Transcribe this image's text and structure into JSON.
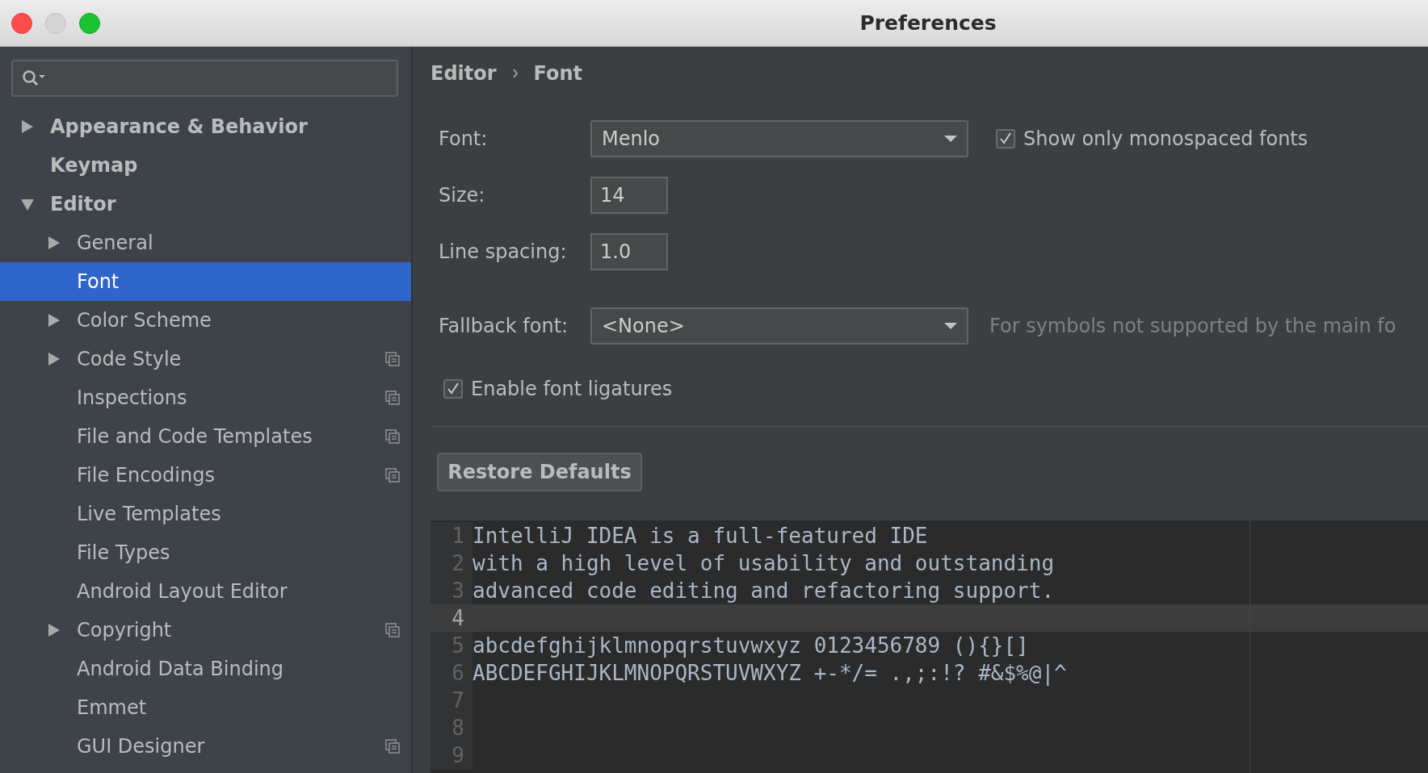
{
  "window": {
    "title": "Preferences"
  },
  "sidebar": {
    "tree": [
      {
        "label": "Appearance & Behavior",
        "kind": "node",
        "expanded": false,
        "bold": true,
        "selected": false,
        "project_icon": false
      },
      {
        "label": "Keymap",
        "kind": "leaf",
        "bold": true,
        "selected": false,
        "project_icon": false
      },
      {
        "label": "Editor",
        "kind": "node",
        "expanded": true,
        "bold": true,
        "selected": false,
        "project_icon": false,
        "children": [
          {
            "label": "General",
            "kind": "node",
            "expanded": false,
            "bold": false,
            "selected": false,
            "project_icon": false
          },
          {
            "label": "Font",
            "kind": "leaf",
            "bold": false,
            "selected": true,
            "project_icon": false
          },
          {
            "label": "Color Scheme",
            "kind": "node",
            "expanded": false,
            "bold": false,
            "selected": false,
            "project_icon": false
          },
          {
            "label": "Code Style",
            "kind": "node",
            "expanded": false,
            "bold": false,
            "selected": false,
            "project_icon": true
          },
          {
            "label": "Inspections",
            "kind": "leaf",
            "bold": false,
            "selected": false,
            "project_icon": true
          },
          {
            "label": "File and Code Templates",
            "kind": "leaf",
            "bold": false,
            "selected": false,
            "project_icon": true
          },
          {
            "label": "File Encodings",
            "kind": "leaf",
            "bold": false,
            "selected": false,
            "project_icon": true
          },
          {
            "label": "Live Templates",
            "kind": "leaf",
            "bold": false,
            "selected": false,
            "project_icon": false
          },
          {
            "label": "File Types",
            "kind": "leaf",
            "bold": false,
            "selected": false,
            "project_icon": false
          },
          {
            "label": "Android Layout Editor",
            "kind": "leaf",
            "bold": false,
            "selected": false,
            "project_icon": false
          },
          {
            "label": "Copyright",
            "kind": "node",
            "expanded": false,
            "bold": false,
            "selected": false,
            "project_icon": true
          },
          {
            "label": "Android Data Binding",
            "kind": "leaf",
            "bold": false,
            "selected": false,
            "project_icon": false
          },
          {
            "label": "Emmet",
            "kind": "leaf",
            "bold": false,
            "selected": false,
            "project_icon": false
          },
          {
            "label": "GUI Designer",
            "kind": "leaf",
            "bold": false,
            "selected": false,
            "project_icon": true
          }
        ]
      }
    ]
  },
  "breadcrumb": [
    "Editor",
    "Font"
  ],
  "form": {
    "font": {
      "label": "Font:",
      "value": "Menlo"
    },
    "monospaced": {
      "label": "Show only monospaced fonts",
      "checked": true
    },
    "size": {
      "label": "Size:",
      "value": "14"
    },
    "line_spacing": {
      "label": "Line spacing:",
      "value": "1.0"
    },
    "fallback": {
      "label": "Fallback font:",
      "value": "<None>",
      "hint": "For symbols not supported by the main fo"
    },
    "ligatures": {
      "label": "Enable font ligatures",
      "checked": true
    },
    "restore_button": "Restore Defaults"
  },
  "preview": {
    "lines": [
      {
        "number": "1",
        "text": "IntelliJ IDEA is a full-featured IDE",
        "current": false
      },
      {
        "number": "2",
        "text": "with a high level of usability and outstanding",
        "current": false
      },
      {
        "number": "3",
        "text": "advanced code editing and refactoring support.",
        "current": false
      },
      {
        "number": "4",
        "current": true
      },
      {
        "number": "5",
        "text": "abcdefghijklmnopqrstuvwxyz 0123456789 (){}[]",
        "current": false
      },
      {
        "number": "6",
        "text": "ABCDEFGHIJKLMNOPQRSTUVWXYZ +-*/= .,;:!? #&$%@|^",
        "current": false
      },
      {
        "number": "7",
        "current": false
      },
      {
        "number": "8",
        "current": false
      },
      {
        "number": "9",
        "current": false
      }
    ]
  }
}
